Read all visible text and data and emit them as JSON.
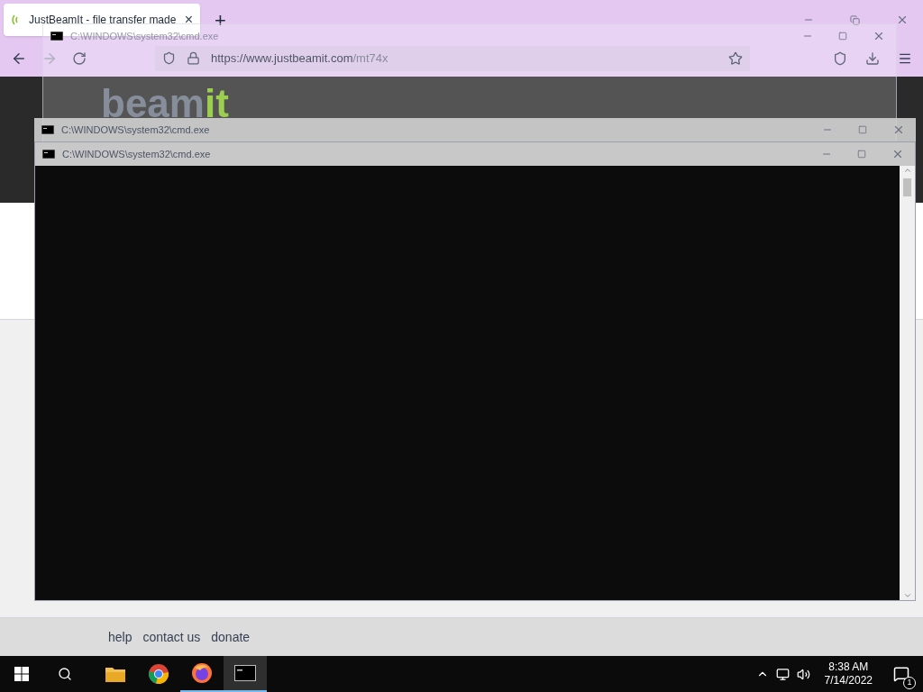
{
  "browser": {
    "tab": {
      "title": "JustBeamIt - file transfer made",
      "close": "×"
    },
    "new_tab": "+",
    "url_host": "https://www.justbeamit.com",
    "url_path": "/mt74x"
  },
  "page": {
    "logo_main": "beam",
    "logo_accent": "it",
    "footer_links": [
      "help",
      "contact us",
      "donate"
    ]
  },
  "cmd_windows": [
    {
      "title": "C:\\WINDOWS\\system32\\cmd.exe",
      "kind": "faint"
    },
    {
      "title": "C:\\WINDOWS\\system32\\cmd.exe",
      "kind": "titlebar"
    },
    {
      "title": "C:\\WINDOWS\\system32\\cmd.exe",
      "kind": "full"
    }
  ],
  "taskbar": {
    "apps": [
      {
        "kind": "explorer",
        "active": false
      },
      {
        "kind": "chrome",
        "active": false
      },
      {
        "kind": "firefox",
        "active": true
      },
      {
        "kind": "cmd",
        "active": true
      }
    ],
    "time": "8:38 AM",
    "date": "7/14/2022",
    "notifications": "1"
  }
}
